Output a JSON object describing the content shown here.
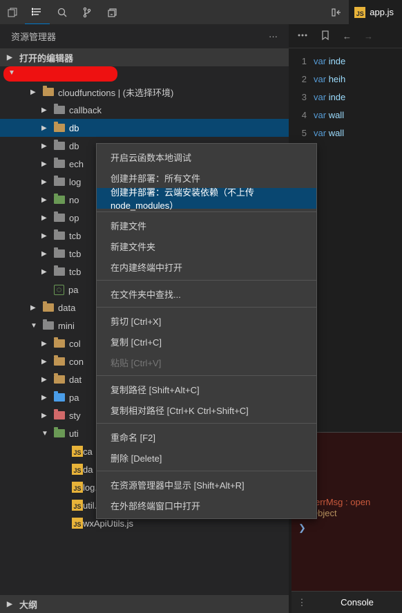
{
  "toolbar": {
    "tab_file": "app.js"
  },
  "sidebar": {
    "title": "资源管理器",
    "open_editors": "打开的编辑器",
    "outline": "大纲",
    "tree": [
      {
        "ind": 44,
        "chv": "▶",
        "cls": "fd",
        "label": "cloudfunctions | (未选择环境)"
      },
      {
        "ind": 60,
        "chv": "▶",
        "cls": "fd g",
        "label": "callback"
      },
      {
        "ind": 60,
        "chv": "▶",
        "cls": "fd",
        "label": "db",
        "sel": true
      },
      {
        "ind": 60,
        "chv": "▶",
        "cls": "fd g",
        "label": "db"
      },
      {
        "ind": 60,
        "chv": "▶",
        "cls": "fd g",
        "label": "ech"
      },
      {
        "ind": 60,
        "chv": "▶",
        "cls": "fd g",
        "label": "log"
      },
      {
        "ind": 60,
        "chv": "▶",
        "cls": "fd gr",
        "label": "no"
      },
      {
        "ind": 60,
        "chv": "▶",
        "cls": "fd g",
        "label": "op"
      },
      {
        "ind": 60,
        "chv": "▶",
        "cls": "fd g",
        "label": "tcb"
      },
      {
        "ind": 60,
        "chv": "▶",
        "cls": "fd g",
        "label": "tcb"
      },
      {
        "ind": 60,
        "chv": "▶",
        "cls": "fd g",
        "label": "tcb"
      },
      {
        "ind": 60,
        "chv": "",
        "cls": "nd",
        "label": "pa"
      },
      {
        "ind": 44,
        "chv": "▶",
        "cls": "fd",
        "label": "data"
      },
      {
        "ind": 44,
        "chv": "▼",
        "cls": "fd g",
        "label": "mini"
      },
      {
        "ind": 60,
        "chv": "▶",
        "cls": "fd",
        "label": "col"
      },
      {
        "ind": 60,
        "chv": "▶",
        "cls": "fd",
        "label": "con"
      },
      {
        "ind": 60,
        "chv": "▶",
        "cls": "fd",
        "label": "dat"
      },
      {
        "ind": 60,
        "chv": "▶",
        "cls": "fd bl",
        "label": "pa"
      },
      {
        "ind": 60,
        "chv": "▶",
        "cls": "fd rd",
        "label": "sty"
      },
      {
        "ind": 60,
        "chv": "▼",
        "cls": "fd gr",
        "label": "uti"
      },
      {
        "ind": 86,
        "chv": "",
        "cls": "js",
        "label": "ca"
      },
      {
        "ind": 86,
        "chv": "",
        "cls": "js",
        "label": "da"
      },
      {
        "ind": 86,
        "chv": "",
        "cls": "js",
        "label": "log.js"
      },
      {
        "ind": 86,
        "chv": "",
        "cls": "js",
        "label": "util.js"
      },
      {
        "ind": 86,
        "chv": "",
        "cls": "js",
        "label": "wxApiUtils.js"
      }
    ]
  },
  "context_menu": [
    {
      "t": "i",
      "label": "开启云函数本地调试"
    },
    {
      "t": "i",
      "label": "创建并部署：所有文件"
    },
    {
      "t": "i",
      "label": "创建并部署：云端安装依赖（不上传 node_modules）",
      "hl": true
    },
    {
      "t": "s"
    },
    {
      "t": "i",
      "label": "新建文件"
    },
    {
      "t": "i",
      "label": "新建文件夹"
    },
    {
      "t": "i",
      "label": "在内建终端中打开"
    },
    {
      "t": "s"
    },
    {
      "t": "i",
      "label": "在文件夹中查找..."
    },
    {
      "t": "s"
    },
    {
      "t": "i",
      "label": "剪切  [Ctrl+X]"
    },
    {
      "t": "i",
      "label": "复制  [Ctrl+C]"
    },
    {
      "t": "i",
      "label": "粘贴  [Ctrl+V]",
      "dis": true
    },
    {
      "t": "s"
    },
    {
      "t": "i",
      "label": "复制路径  [Shift+Alt+C]"
    },
    {
      "t": "i",
      "label": "复制相对路径  [Ctrl+K Ctrl+Shift+C]"
    },
    {
      "t": "s"
    },
    {
      "t": "i",
      "label": "重命名  [F2]"
    },
    {
      "t": "i",
      "label": "删除  [Delete]"
    },
    {
      "t": "s"
    },
    {
      "t": "i",
      "label": "在资源管理器中显示  [Shift+Alt+R]"
    },
    {
      "t": "i",
      "label": "在外部终端窗口中打开"
    }
  ],
  "code": {
    "lines": [
      1,
      2,
      3,
      4,
      5
    ],
    "vars": [
      "inde",
      "heih",
      "inde",
      "wall",
      "wall"
    ]
  },
  "console": {
    "err": "errMsg : open",
    "obj": "Object",
    "tab": "Console"
  }
}
